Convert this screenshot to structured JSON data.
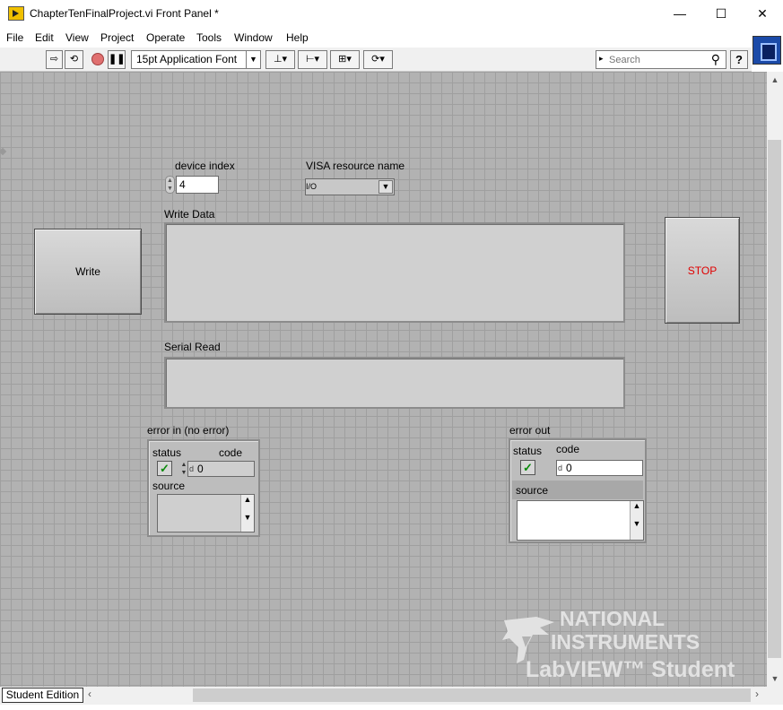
{
  "window": {
    "title": "ChapterTenFinalProject.vi Front Panel *",
    "minimize": "—",
    "maximize": "☐",
    "close": "✕"
  },
  "menu": [
    "File",
    "Edit",
    "View",
    "Project",
    "Operate",
    "Tools",
    "Window",
    "Help"
  ],
  "toolbar": {
    "font": "15pt Application Font",
    "search_placeholder": "Search",
    "help": "?"
  },
  "panel": {
    "device_index": {
      "label": "device index",
      "value": "4"
    },
    "visa": {
      "label": "VISA resource name",
      "value": ""
    },
    "write_button": "Write",
    "write_data": {
      "label": "Write Data",
      "value": ""
    },
    "stop_button": "STOP",
    "serial_read": {
      "label": "Serial Read",
      "value": ""
    },
    "error_in": {
      "label": "error in (no error)",
      "status_label": "status",
      "code_label": "code",
      "code_value": "0",
      "source_label": "source"
    },
    "error_out": {
      "label": "error out",
      "status_label": "status",
      "code_label": "code",
      "code_value": "0",
      "source_label": "source"
    }
  },
  "watermark": {
    "line1": "NATIONAL",
    "line2": "INSTRUMENTS",
    "line3": "LabVIEW™ Student Edition"
  },
  "status": {
    "edition": "Student Edition"
  },
  "colors": {
    "stop_text": "#e00000",
    "check": "#0b8a0b",
    "grid_bg": "#b2b2b2"
  }
}
